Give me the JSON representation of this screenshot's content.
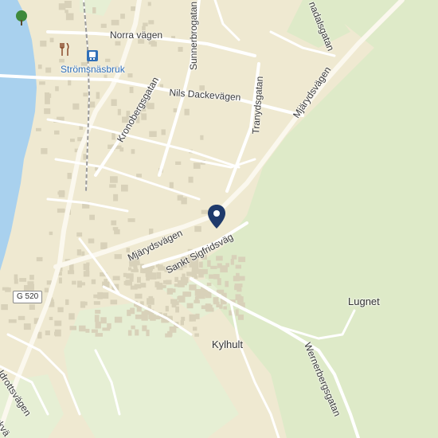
{
  "colors": {
    "land": "#efe9d1",
    "forest": "#deeac8",
    "forest_light": "#e6efd4",
    "water": "#a9d1ee",
    "road": "#ffffff",
    "road_major": "#fbf8ee",
    "building": "#d8d1b9",
    "rail": "#9a9a9a",
    "pin": "#1f3a6b",
    "poi_blue": "#2f6fb8",
    "tree_icon": "#3f8a3c"
  },
  "places": {
    "town": "Strömsnäsbruk",
    "lugnet": "Lugnet",
    "kylhult": "Kylhult"
  },
  "streets": {
    "norra": "Norra vägen",
    "sunnerbro": "Sunnerbrogatan",
    "nils": "Nils Dackevägen",
    "tranyd": "Tranydsgatan",
    "kronoberg": "Kronobergsgatan",
    "mjarydsvagen_upper": "Mjärydsvägen",
    "mjarydsvagen_lower": "Mjärydsvägen",
    "sigfrid": "Sankt Sigfridsväg",
    "gatan_top": "nadalsgatan",
    "wernerberg": "Wernerbergsgatan",
    "idrott": "Idrottsvägen",
    "bottom_left": "ckvä"
  },
  "road_shield": "G 520",
  "icons": {
    "park": "tree-icon",
    "restaurant": "fork-knife-icon",
    "station": "train-station-icon",
    "pin": "location-pin-icon"
  }
}
